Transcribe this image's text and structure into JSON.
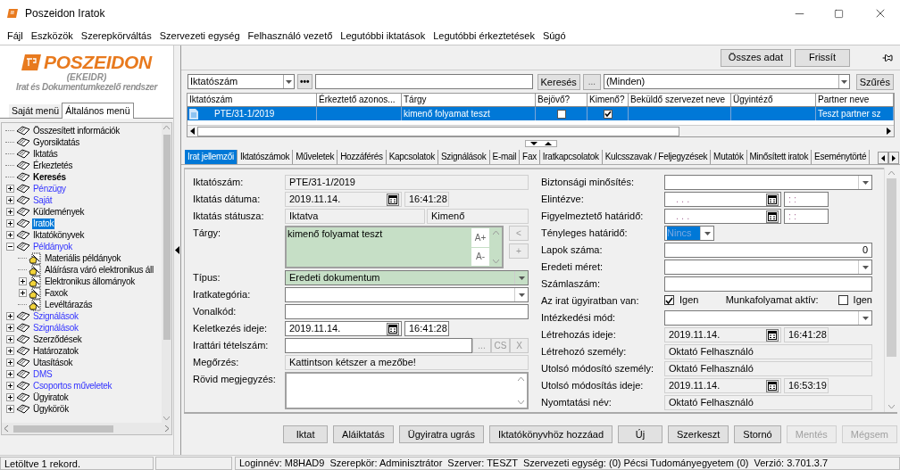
{
  "window": {
    "title": "Poszeidon Iratok"
  },
  "menu": [
    "Fájl",
    "Eszközök",
    "Szerepkörváltás",
    "Szervezeti egység",
    "Felhasználó vezető",
    "Legutóbbi iktatások",
    "Legutóbbi érkeztetések",
    "Súgó"
  ],
  "sidebar": {
    "logo": {
      "name": "POSZEIDON",
      "subtitle": "(EKEIDR)",
      "tagline": "Irat és Dokumentumkezelő rendszer"
    },
    "tabs": [
      {
        "label": "Saját menü",
        "selected": false
      },
      {
        "label": "Általános menü",
        "selected": true
      }
    ],
    "tree": [
      {
        "label": "Összesített információk",
        "kind": "normal",
        "selected": false
      },
      {
        "label": "Gyorsiktatás",
        "kind": "normal",
        "selected": false
      },
      {
        "label": "Iktatás",
        "kind": "normal",
        "selected": false
      },
      {
        "label": "Érkeztetés",
        "kind": "normal",
        "selected": false
      },
      {
        "label": "Keresés",
        "kind": "bold",
        "selected": false
      },
      {
        "label": "Pénzügy",
        "kind": "link",
        "selected": false,
        "expanded": false
      },
      {
        "label": "Saját",
        "kind": "link",
        "selected": false,
        "expanded": false
      },
      {
        "label": "Küldemények",
        "kind": "normal",
        "selected": false,
        "expanded": false
      },
      {
        "label": "Iratok",
        "kind": "normal",
        "selected": true,
        "expanded": false
      },
      {
        "label": "Iktatókönyvek",
        "kind": "normal",
        "selected": false,
        "expanded": false
      },
      {
        "label": "Példányok",
        "kind": "link",
        "selected": false,
        "expanded": true,
        "children": [
          {
            "label": "Materiális példányok",
            "kind": "normal",
            "selected": false
          },
          {
            "label": "Aláírásra váró elektronikus áll",
            "kind": "normal",
            "selected": false
          },
          {
            "label": "Elektronikus állományok",
            "kind": "normal",
            "selected": false,
            "expanded": false
          },
          {
            "label": "Faxok",
            "kind": "normal",
            "selected": false,
            "expanded": false
          },
          {
            "label": "Levéltárazás",
            "kind": "normal",
            "selected": false
          }
        ]
      },
      {
        "label": "Szignálások",
        "kind": "link",
        "selected": false,
        "expanded": false
      },
      {
        "label": "Szignálások",
        "kind": "link",
        "selected": false,
        "expanded": false
      },
      {
        "label": "Szerződések",
        "kind": "normal",
        "selected": false,
        "expanded": false
      },
      {
        "label": "Határozatok",
        "kind": "normal",
        "selected": false,
        "expanded": false
      },
      {
        "label": "Utasítások",
        "kind": "normal",
        "selected": false,
        "expanded": false
      },
      {
        "label": "DMS",
        "kind": "link",
        "selected": false,
        "expanded": false
      },
      {
        "label": "Csoportos műveletek",
        "kind": "link",
        "selected": false,
        "expanded": false
      },
      {
        "label": "Ügyiratok",
        "kind": "normal",
        "selected": false,
        "expanded": false
      },
      {
        "label": "Ügykörök",
        "kind": "normal",
        "selected": false,
        "expanded": false
      }
    ]
  },
  "toolbar": {
    "buttons": [
      "Összes adat",
      "Frissít"
    ]
  },
  "search": {
    "field": "Iktatószám",
    "more_button": "•••",
    "search_button": "Keresés",
    "ellipsis_button": "...",
    "filter": "(Minden)",
    "filter_button": "Szűrés"
  },
  "table": {
    "columns": [
      {
        "label": "Iktatószám",
        "kind": "text"
      },
      {
        "label": "Érkeztető azonos...",
        "kind": "text"
      },
      {
        "label": "Tárgy",
        "kind": "text"
      },
      {
        "label": "Bejövő?",
        "kind": "check"
      },
      {
        "label": "Kimenő?",
        "kind": "check"
      },
      {
        "label": "Beküldő szervezet neve",
        "kind": "text"
      },
      {
        "label": "Ügyintéző",
        "kind": "text"
      },
      {
        "label": "Partner neve",
        "kind": "text"
      }
    ],
    "rows": [
      {
        "selected": true,
        "cells": [
          "PTE/31-1/2019",
          null,
          "kimenő folyamat teszt",
          false,
          true,
          null,
          null,
          "Teszt partner sz"
        ]
      }
    ]
  },
  "tabs": [
    {
      "label": "Irat jellemzői",
      "selected": true
    },
    {
      "label": "Iktatószámok",
      "selected": false
    },
    {
      "label": "Műveletek",
      "selected": false
    },
    {
      "label": "Hozzáférés",
      "selected": false
    },
    {
      "label": "Kapcsolatok",
      "selected": false
    },
    {
      "label": "Szignálások",
      "selected": false
    },
    {
      "label": "E-mail",
      "selected": false
    },
    {
      "label": "Fax",
      "selected": false
    },
    {
      "label": "Iratkapcsolatok",
      "selected": false
    },
    {
      "label": "Kulcsszavak / Feljegyzések",
      "selected": false
    },
    {
      "label": "Mutatók",
      "selected": false
    },
    {
      "label": "Minősített iratok",
      "selected": false
    },
    {
      "label": "Eseménytörté",
      "selected": false
    }
  ],
  "form": {
    "left": [
      {
        "label": "Iktatószám:",
        "kind": "readonly",
        "required": false,
        "value": "PTE/31-1/2019"
      },
      {
        "label": "Iktatás dátuma:",
        "kind": "date",
        "required": false,
        "readonly": true,
        "date": "2019.11.14.",
        "time": "16:41:28"
      },
      {
        "label": "Iktatás státusza:",
        "kind": "pair",
        "required": false,
        "values": [
          "Iktatva",
          "Kimenő"
        ]
      },
      {
        "label": "Tárgy:",
        "kind": "subject",
        "required": true,
        "value": "kimenő folyamat teszt",
        "buttons": [
          "A+",
          "A-"
        ],
        "side_buttons": [
          "<",
          "+"
        ]
      },
      {
        "label": "Típus:",
        "kind": "combo",
        "required": true,
        "value": "Eredeti dokumentum"
      },
      {
        "label": "Iratkategória:",
        "kind": "combo",
        "required": false
      },
      {
        "label": "Vonalkód:",
        "kind": "input",
        "required": false
      },
      {
        "label": "Keletkezés ideje:",
        "kind": "date",
        "required": false,
        "readonly": false,
        "date": "2019.11.14.",
        "time": "16:41:28"
      },
      {
        "label": "Irattári tételszám:",
        "kind": "lookup",
        "required": false,
        "buttons": [
          "...",
          "CS",
          "X"
        ]
      },
      {
        "label": "Megőrzés:",
        "kind": "readonly",
        "required": false,
        "value": "Kattintson kétszer a mezőbe!"
      },
      {
        "label": "Rövid megjegyzés:",
        "kind": "memo",
        "required": false
      }
    ],
    "right": [
      {
        "label": "Biztonsági minősítés:",
        "kind": "combo",
        "required": false
      },
      {
        "label": "Elintézve:",
        "kind": "date",
        "required": false,
        "readonly": false,
        "date": ". . .",
        "time": ": :"
      },
      {
        "label": "Figyelmeztető határidő:",
        "kind": "date",
        "required": false,
        "readonly": false,
        "date": ". . .",
        "time": ": :"
      },
      {
        "label": "Tényleges határidő:",
        "kind": "small_combo",
        "required": false,
        "value": "Nincs",
        "highlighted": true
      },
      {
        "label": "Lapok száma:",
        "kind": "number",
        "required": false,
        "value": "0"
      },
      {
        "label": "Eredeti méret:",
        "kind": "combo",
        "required": false
      },
      {
        "label": "Számlaszám:",
        "kind": "input",
        "required": false
      },
      {
        "label": "Az irat ügyiratban van:",
        "kind": "checks",
        "required": false,
        "checks": [
          {
            "label": "Igen",
            "checked": true
          },
          {
            "label": "Igen",
            "checked": false
          }
        ],
        "second_label": "Munkafolyamat aktív:"
      },
      {
        "label": "Intézkedési mód:",
        "kind": "combo",
        "required": false
      },
      {
        "label": "Létrehozás ideje:",
        "kind": "date",
        "required": false,
        "readonly": true,
        "date": "2019.11.14.",
        "time": "16:41:28"
      },
      {
        "label": "Létrehozó személy:",
        "kind": "readonly",
        "required": false,
        "value": "Oktató Felhasználó"
      },
      {
        "label": "Utolsó módosító személy:",
        "kind": "readonly",
        "required": false,
        "value": "Oktató Felhasználó"
      },
      {
        "label": "Utolsó módosítás ideje:",
        "kind": "date",
        "required": false,
        "readonly": true,
        "date": "2019.11.14.",
        "time": "16:53:19"
      },
      {
        "label": "Nyomtatási név:",
        "kind": "readonly",
        "required": false,
        "value": "Oktató Felhasználó"
      }
    ]
  },
  "actions": [
    {
      "label": "Iktat",
      "disabled": false
    },
    {
      "label": "Aláiktatás",
      "disabled": false
    },
    {
      "label": "Ügyiratra ugrás",
      "disabled": false
    },
    {
      "label": "Iktatókönyvhöz hozzáad",
      "disabled": false
    },
    {
      "label": "Új",
      "disabled": false
    },
    {
      "label": "Szerkeszt",
      "disabled": false
    },
    {
      "label": "Stornó",
      "disabled": false
    },
    {
      "label": "Mentés",
      "disabled": true
    },
    {
      "label": "Mégsem",
      "disabled": true
    }
  ],
  "status_bar": {
    "message": "Letöltve 1 rekord.",
    "items": [
      "Loginnév: M8HAD9",
      "Szerepkör: Adminisztrátor",
      "Szerver: TESZT",
      "Szervezeti egység: (0) Pécsi Tudományegyetem (0)",
      "Verzió: 3.701.3.7"
    ]
  }
}
